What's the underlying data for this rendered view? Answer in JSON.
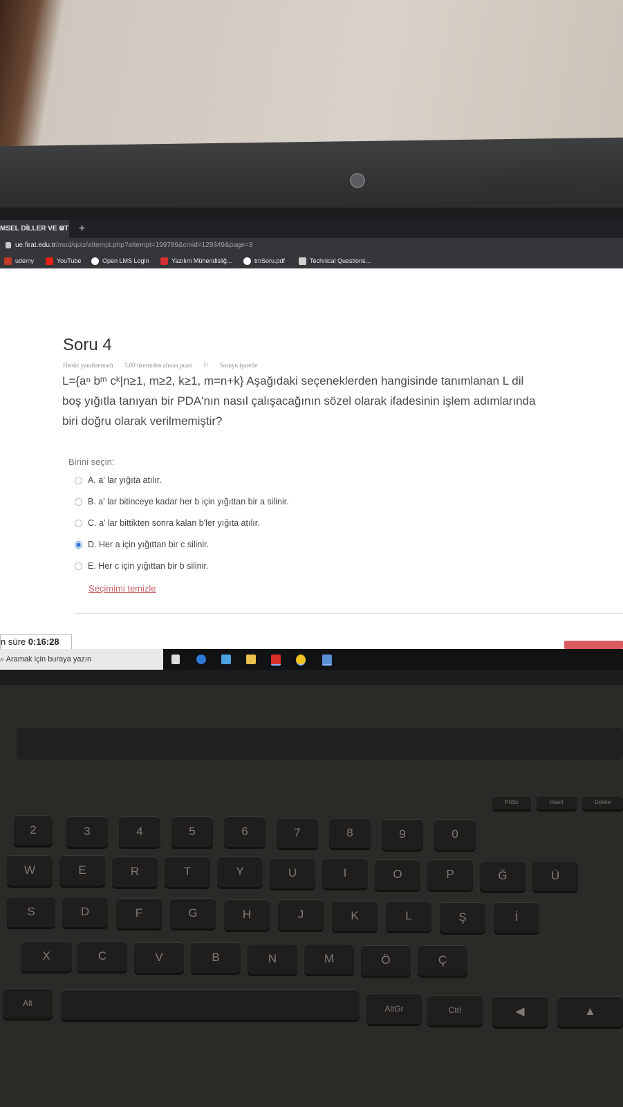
{
  "browser": {
    "tab_title": "MSEL DİLLER VE OT",
    "tab_close": "×",
    "new_tab": "+",
    "url_host": "ue.firat.edu.tr",
    "url_path": "/mod/quiz/attempt.php?attempt=199789&cmid=129349&page=3",
    "bookmarks": [
      {
        "label": "udemy",
        "color": "#c0392b"
      },
      {
        "label": "YouTube",
        "color": "#e62117"
      },
      {
        "label": "Open LMS Login",
        "color": "#ffffff"
      },
      {
        "label": "Yazılım Mühendisliğ...",
        "color": "#d03030"
      },
      {
        "label": "tmSoru.pdf",
        "color": "#ffffff"
      },
      {
        "label": "Technical Questions...",
        "color": "#cfcfcf"
      }
    ]
  },
  "question": {
    "title": "Soru 4",
    "status": "Henüz yanıtlanmadı",
    "points": "5.00 üzerinden alınan puan",
    "flag_label": "Soruyu işaretle",
    "text_lines": [
      "L={aⁿ bᵐ cᵏ|n≥1, m≥2, k≥1, m=n+k} Aşağıdaki seçeneklerden hangisinde tanımlanan L dil",
      "boş yığıtla tanıyan bir PDA'nın nasıl çalışacağının sözel olarak ifadesinin işlem adımlarında",
      "biri doğru olarak verilmemiştir?"
    ],
    "choose_label": "Birini seçin:",
    "options": [
      {
        "label": "A. a' lar yığıta atılır.",
        "selected": false
      },
      {
        "label": "B. a' lar bitinceye kadar her b için yığıttan bir a silinir.",
        "selected": false
      },
      {
        "label": "C. a' lar bittikten sonra kalan b'ler yığıta atılır.",
        "selected": false
      },
      {
        "label": "D. Her a için yığıttan bir c silinir.",
        "selected": true
      },
      {
        "label": "E. Her c için yığıttan bir b silinir.",
        "selected": false
      }
    ],
    "clear_choice": "Seçimimi temizle"
  },
  "timer": {
    "prefix": "n süre",
    "value": "0:16:28"
  },
  "taskbar": {
    "search_placeholder": "Aramak için buraya yazın"
  },
  "keyboard": {
    "row_num": [
      "2",
      "3",
      "4",
      "5",
      "6",
      "7",
      "8",
      "9",
      "0"
    ],
    "row_q": [
      "W",
      "E",
      "R",
      "T",
      "Y",
      "U",
      "I",
      "O",
      "P",
      "Ğ",
      "Ü"
    ],
    "row_a": [
      "S",
      "D",
      "F",
      "G",
      "H",
      "J",
      "K",
      "L",
      "Ş",
      "İ"
    ],
    "row_z": [
      "X",
      "C",
      "V",
      "B",
      "N",
      "M",
      "Ö",
      "Ç"
    ],
    "row_bottom": [
      "Alt",
      "AltGr",
      "Ctrl"
    ],
    "fn_labels": [
      "PrtSc",
      "Insert",
      "Delete"
    ]
  }
}
